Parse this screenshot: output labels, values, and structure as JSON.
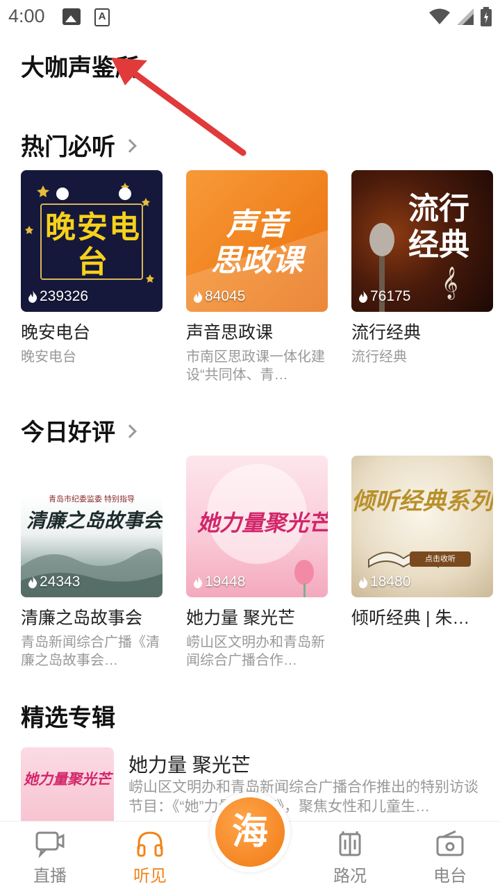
{
  "status": {
    "time": "4:00"
  },
  "page_title": "大咖声鉴所",
  "sections": {
    "hot": {
      "title": "热门必听",
      "items": [
        {
          "cover_text": "晚安电台",
          "count": "239326",
          "title": "晚安电台",
          "desc": "晚安电台"
        },
        {
          "cover_text_1": "声音",
          "cover_text_2": "思政课",
          "count": "84045",
          "title": "声音思政课",
          "desc": "市南区思政课一体化建设“共同体、青…"
        },
        {
          "cover_text_1": "流行",
          "cover_text_2": "经典",
          "count": "76175",
          "title": "流行经典",
          "desc": "流行经典"
        }
      ]
    },
    "today": {
      "title": "今日好评",
      "items": [
        {
          "cover_small": "青岛市纪委监委  特别指导",
          "cover_text": "清廉之岛故事会",
          "count": "24343",
          "title": "清廉之岛故事会",
          "desc": "青岛新闻综合广播《清廉之岛故事会…"
        },
        {
          "cover_text": "她力量聚光芒",
          "count": "19448",
          "title": "她力量 聚光芒",
          "desc": "崂山区文明办和青岛新闻综合广播合作…"
        },
        {
          "cover_text": "倾听经典系列",
          "cover_small": "点击收听",
          "count": "18480",
          "title": "倾听经典 | 朱…",
          "desc": ""
        }
      ]
    },
    "albums": {
      "title": "精选专辑",
      "items": [
        {
          "cover_text": "她力量聚光芒",
          "title": "她力量 聚光芒",
          "desc": "崂山区文明办和青岛新闻综合广播合作推出的特别访谈节目：《“她”力量聚光芒》，聚焦女性和儿童生…"
        }
      ]
    }
  },
  "tabs": [
    {
      "label": "直播",
      "icon": "video-chat-icon"
    },
    {
      "label": "听见",
      "icon": "headphones-icon"
    },
    {
      "label": "海",
      "icon": "center-logo"
    },
    {
      "label": "路况",
      "icon": "traffic-icon"
    },
    {
      "label": "电台",
      "icon": "radio-icon"
    }
  ],
  "colors": {
    "accent": "#f08419",
    "annotation_arrow": "#e03a3a"
  }
}
